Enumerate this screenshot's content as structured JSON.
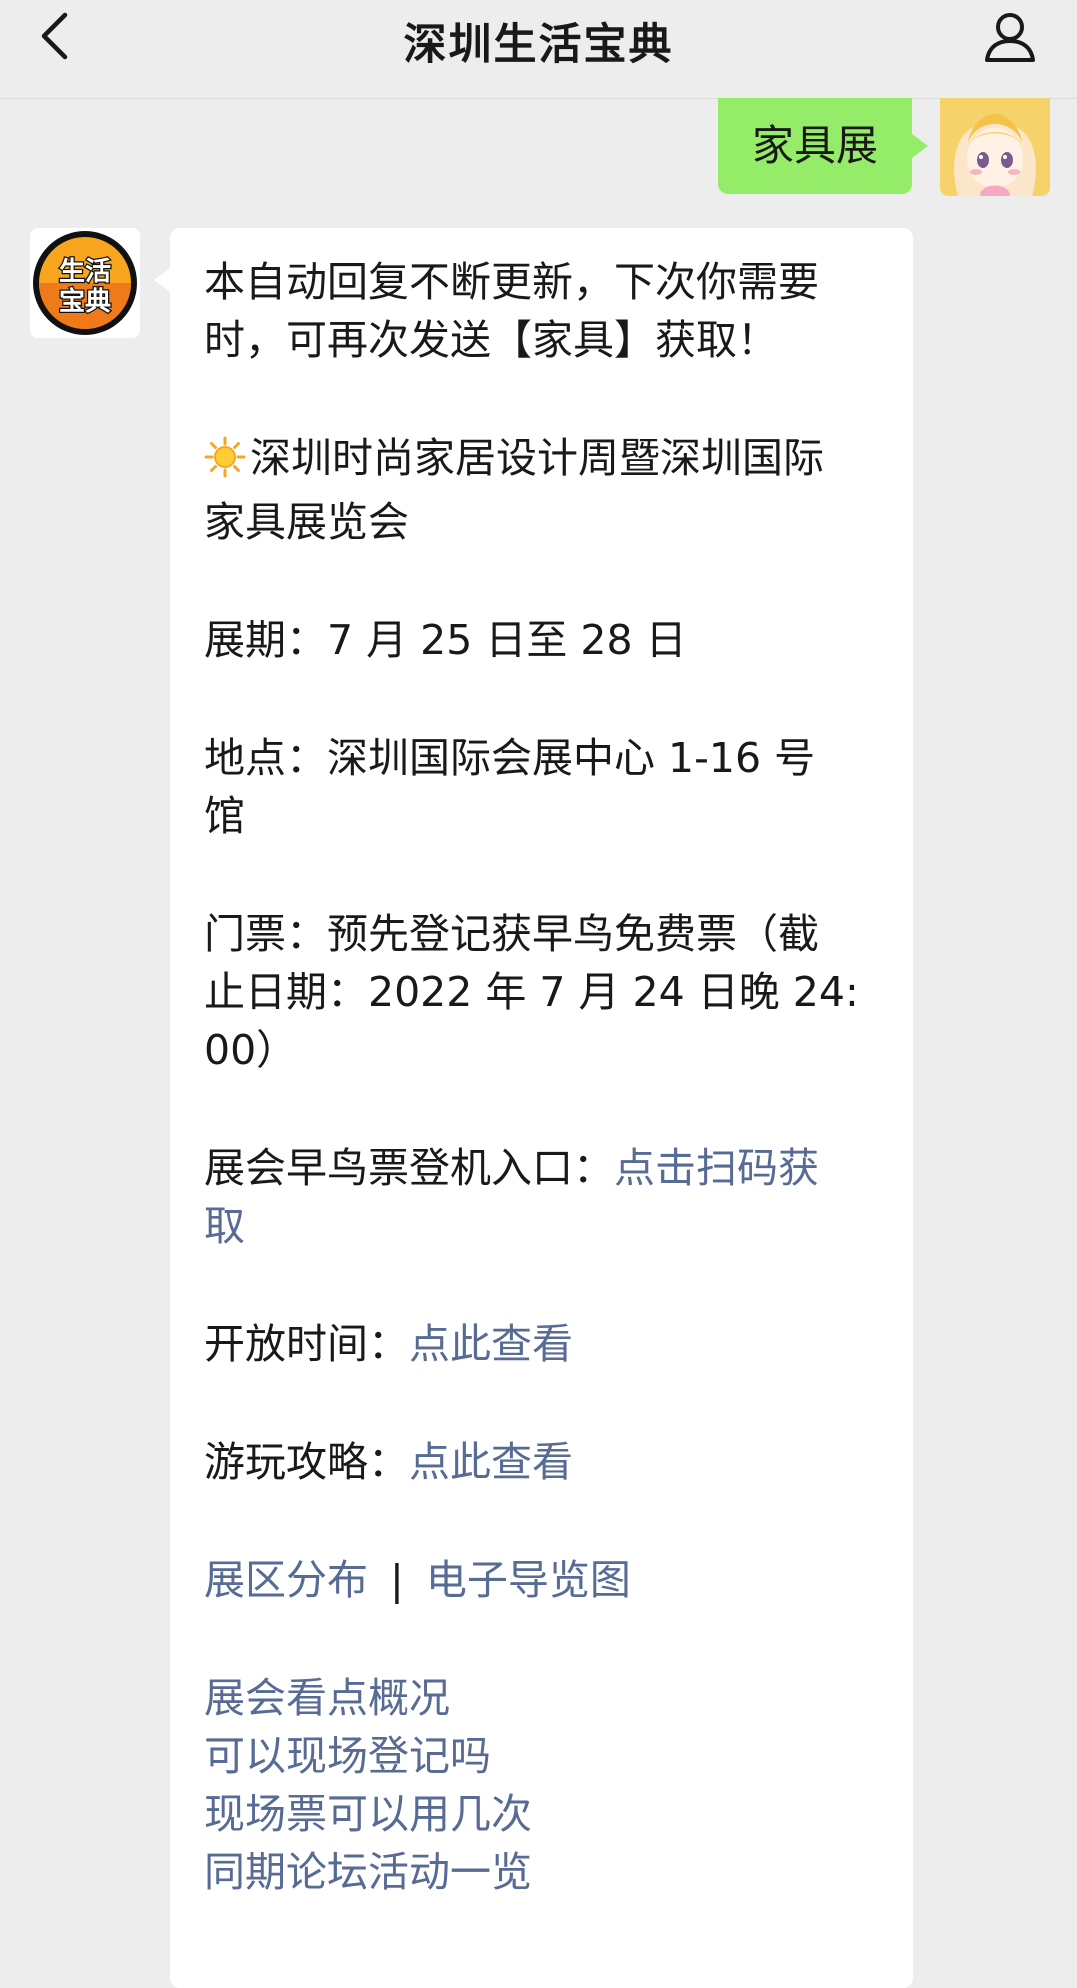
{
  "header": {
    "title": "深圳生活宝典",
    "back_icon": "chevron-left-icon",
    "profile_icon": "person-icon"
  },
  "outgoing": {
    "text": "家具展",
    "bubble_color": "#95ec69"
  },
  "bot": {
    "avatar_line1": "生活",
    "avatar_line2": "宝典"
  },
  "reply": {
    "intro_1": "本自动回复不断更新，下次你需要",
    "intro_2": "时，可再次发送【家具】获取！",
    "event_title_1": "深圳时尚家居设计周暨深圳国际",
    "event_title_2": "家具展览会",
    "dates": "展期：7 月 25 日至 28 日",
    "venue_1": "地点：深圳国际会展中心  1-16 号",
    "venue_2": "馆",
    "ticket_1": "门票：预先登记获早鸟免费票（截",
    "ticket_2": "止日期：2022 年 7 月 24 日晚 24:",
    "ticket_3": "00）",
    "entry_label": "展会早鸟票登机入口：",
    "entry_link_1": "点击扫码获",
    "entry_link_2": "取",
    "hours_label": "开放时间：",
    "hours_link": "点此查看",
    "guide_label": "游玩攻略：",
    "guide_link": "点此查看",
    "zone_link": "展区分布",
    "separator": "|",
    "map_link": "电子导览图",
    "more_links": [
      "展会看点概况",
      "可以现场登记吗",
      "现场票可以用几次",
      "同期论坛活动一览"
    ],
    "link_color": "#576b95"
  }
}
